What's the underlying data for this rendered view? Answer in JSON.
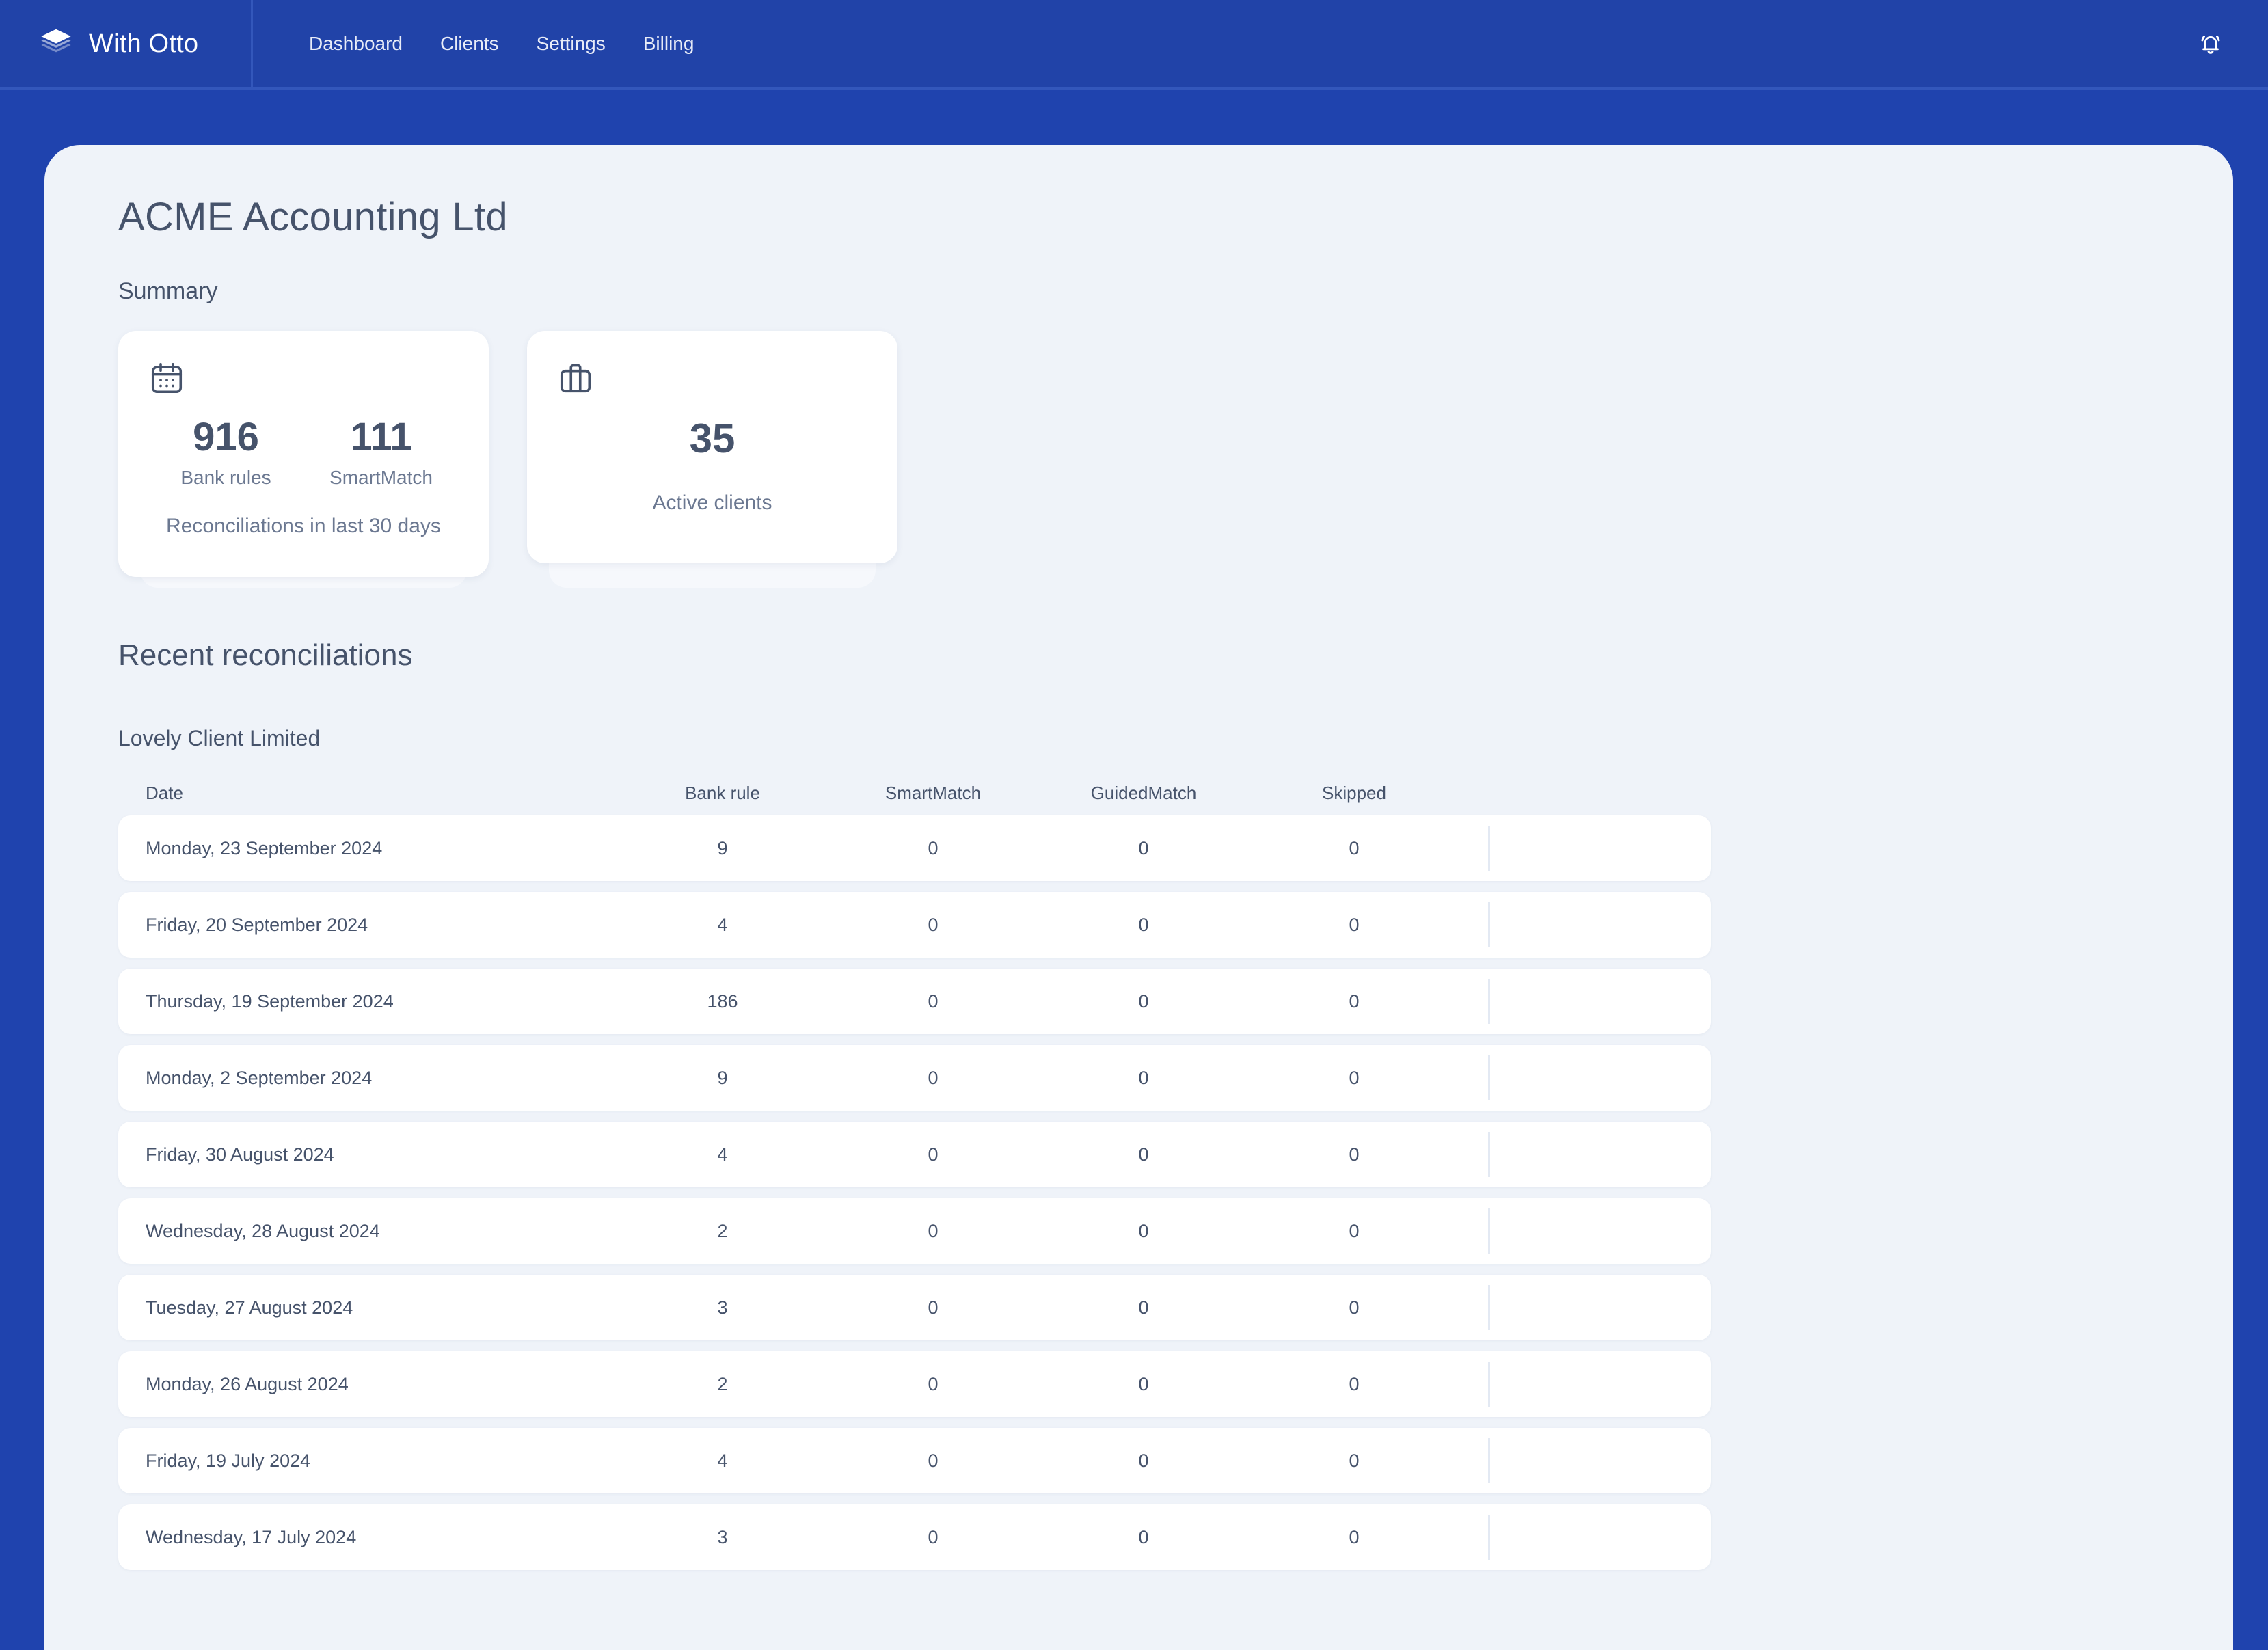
{
  "header": {
    "brand_name": "With Otto",
    "logo_icon": "layers-icon",
    "nav": [
      {
        "label": "Dashboard"
      },
      {
        "label": "Clients"
      },
      {
        "label": "Settings"
      },
      {
        "label": "Billing"
      }
    ],
    "notifications_icon": "bell-icon",
    "background_color": "#2143a8"
  },
  "page": {
    "title": "ACME Accounting Ltd",
    "summary_label": "Summary"
  },
  "summary_cards": [
    {
      "icon": "calendar-icon",
      "stats": [
        {
          "value": "916",
          "label": "Bank rules"
        },
        {
          "value": "111",
          "label": "SmartMatch"
        }
      ],
      "caption": "Reconciliations in last 30 days"
    },
    {
      "icon": "briefcase-icon",
      "stats": [
        {
          "value": "35",
          "label": ""
        }
      ],
      "caption": "Active clients"
    }
  ],
  "recent": {
    "heading": "Recent reconciliations",
    "client_name": "Lovely Client Limited",
    "columns": [
      "Date",
      "Bank rule",
      "SmartMatch",
      "GuidedMatch",
      "Skipped"
    ],
    "rows": [
      {
        "date": "Monday, 23 September 2024",
        "bank_rule": "9",
        "smart_match": "0",
        "guided_match": "0",
        "skipped": "0"
      },
      {
        "date": "Friday, 20 September 2024",
        "bank_rule": "4",
        "smart_match": "0",
        "guided_match": "0",
        "skipped": "0"
      },
      {
        "date": "Thursday, 19 September 2024",
        "bank_rule": "186",
        "smart_match": "0",
        "guided_match": "0",
        "skipped": "0"
      },
      {
        "date": "Monday, 2 September 2024",
        "bank_rule": "9",
        "smart_match": "0",
        "guided_match": "0",
        "skipped": "0"
      },
      {
        "date": "Friday, 30 August 2024",
        "bank_rule": "4",
        "smart_match": "0",
        "guided_match": "0",
        "skipped": "0"
      },
      {
        "date": "Wednesday, 28 August 2024",
        "bank_rule": "2",
        "smart_match": "0",
        "guided_match": "0",
        "skipped": "0"
      },
      {
        "date": "Tuesday, 27 August 2024",
        "bank_rule": "3",
        "smart_match": "0",
        "guided_match": "0",
        "skipped": "0"
      },
      {
        "date": "Monday, 26 August 2024",
        "bank_rule": "2",
        "smart_match": "0",
        "guided_match": "0",
        "skipped": "0"
      },
      {
        "date": "Friday, 19 July 2024",
        "bank_rule": "4",
        "smart_match": "0",
        "guided_match": "0",
        "skipped": "0"
      },
      {
        "date": "Wednesday, 17 July 2024",
        "bank_rule": "3",
        "smart_match": "0",
        "guided_match": "0",
        "skipped": "0"
      }
    ]
  },
  "colors": {
    "brand_blue": "#2143a8",
    "panel_bg": "#eff3f9",
    "text_primary": "#46536b",
    "text_muted": "#6b7891",
    "card_bg": "#ffffff"
  }
}
